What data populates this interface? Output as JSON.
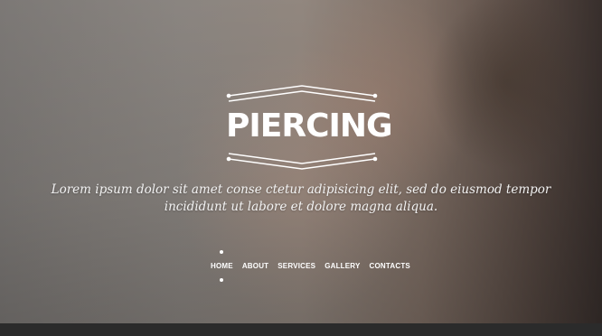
{
  "logo": {
    "text": "PIERCING"
  },
  "tagline": {
    "line1": "Lorem ipsum dolor sit amet conse ctetur adipisicing elit, sed do eiusmod tempor",
    "line2": "incididunt ut labore et dolore magna aliqua."
  },
  "nav": {
    "items": [
      {
        "label": "HOME",
        "active": true
      },
      {
        "label": "ABOUT",
        "active": false
      },
      {
        "label": "SERVICES",
        "active": false
      },
      {
        "label": "GALLERY",
        "active": false
      },
      {
        "label": "CONTACTS",
        "active": false
      }
    ]
  },
  "colors": {
    "text": "#ffffff",
    "footer_bar": "#2b2b2b"
  }
}
